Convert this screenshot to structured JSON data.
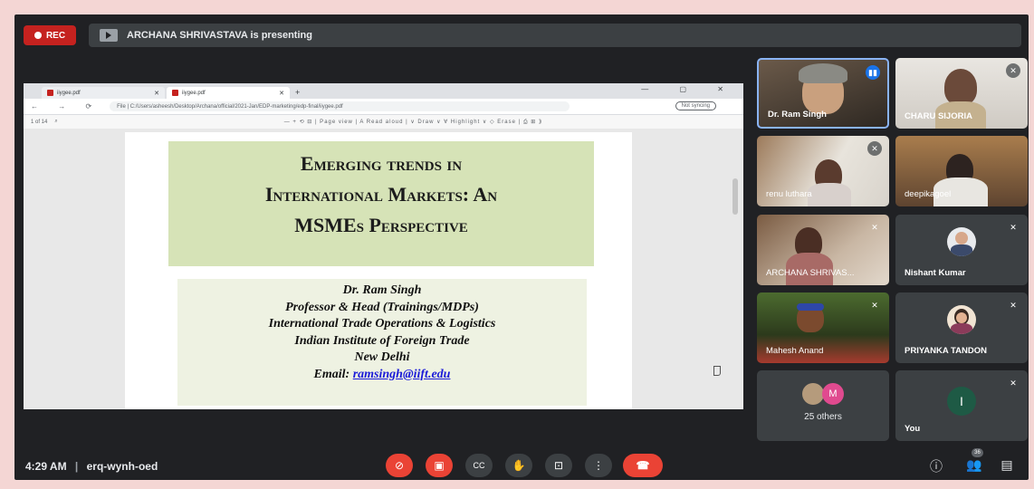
{
  "top_bar": {
    "rec_label": "REC",
    "presenting_text": "ARCHANA SHRIVASTAVA is presenting"
  },
  "browser": {
    "tabs": [
      {
        "label": "iiygee.pdf"
      },
      {
        "label": "iiygee.pdf"
      }
    ],
    "window_controls": "— ▢ ✕",
    "nav": "← → ⟳",
    "url": "File  |  C:/Users/asheesh/Desktop/Archana/official/2021-Jan/EDP-marketing/edp-final/iiygee.pdf",
    "sync_label": "Not syncing",
    "pdf_page": "1  of 14",
    "pdf_tools": "—  +  ⟲  ⊟  |  Page view  |  A Read aloud  |  ∨ Draw  ∨  ∀ Highlight  ∨  ◇ Erase  |  ⎙  ⊞  ⟫"
  },
  "slide": {
    "title_lines": [
      "Emerging trends in",
      "International Markets: An",
      "MSMEs Perspective"
    ],
    "author_lines": [
      "Dr. Ram Singh",
      "Professor  & Head (Trainings/MDPs)",
      "International Trade Operations & Logistics",
      "Indian Institute of Foreign Trade",
      "New Delhi"
    ],
    "email_label": "Email: ",
    "email": "ramsingh@iift.edu"
  },
  "participants": [
    {
      "name": "Dr. Ram Singh"
    },
    {
      "name": "CHARU SIJORIA"
    },
    {
      "name": "renu luthara"
    },
    {
      "name": "deepikagoel"
    },
    {
      "name": "ARCHANA SHRIVAS..."
    },
    {
      "name": "Nishant Kumar"
    },
    {
      "name": "Mahesh Anand"
    },
    {
      "name": "PRIYANKA TANDON"
    },
    {
      "name": "25 others",
      "avatar_letter": "M"
    },
    {
      "name": "You",
      "avatar_letter": "I"
    }
  ],
  "bottom_bar": {
    "time": "4:29 AM",
    "meeting_code": "erq-wynh-oed",
    "people_count": "36"
  },
  "colors": {
    "background": "#202124",
    "danger": "#ea4335",
    "tile": "#3c4043",
    "slide_title_bg": "#d6e3b7"
  }
}
